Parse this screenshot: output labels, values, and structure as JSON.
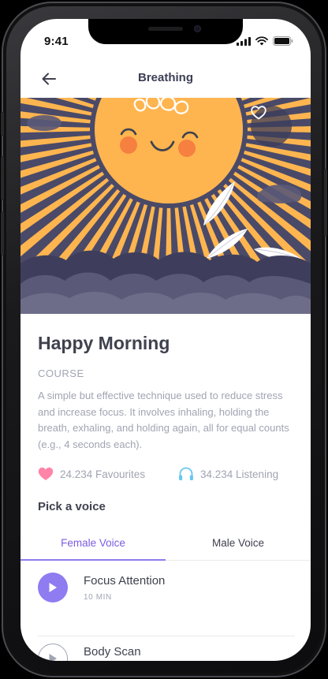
{
  "status_bar": {
    "time": "9:41"
  },
  "navbar": {
    "title": "Breathing",
    "back_icon": "arrow-left-icon"
  },
  "hero": {
    "favorite_icon": "heart-outline-icon"
  },
  "course": {
    "title": "Happy Morning",
    "type": "COURSE",
    "description": "A simple but effective technique used to reduce stress and increase focus. It involves inhaling, holding the breath, exhaling, and holding again, all for equal counts (e.g., 4 seconds each).",
    "favourites": "24.234 Favourites",
    "listening": "34.234 Listening"
  },
  "voice": {
    "heading": "Pick a voice",
    "tabs": [
      {
        "label": "Female Voice",
        "active": true
      },
      {
        "label": "Male Voice",
        "active": false
      }
    ]
  },
  "tracks": [
    {
      "name": "Focus Attention",
      "duration": "10 MIN"
    },
    {
      "name": "Body Scan",
      "duration": ""
    }
  ],
  "colors": {
    "accent": "#8e7cf0",
    "title_text": "#3f414e",
    "muted_text": "#a1a4b2",
    "heart": "#ff84a8",
    "headphones": "#67c8f0",
    "sun": "#ffb54f",
    "sky": "#4a4a68"
  }
}
